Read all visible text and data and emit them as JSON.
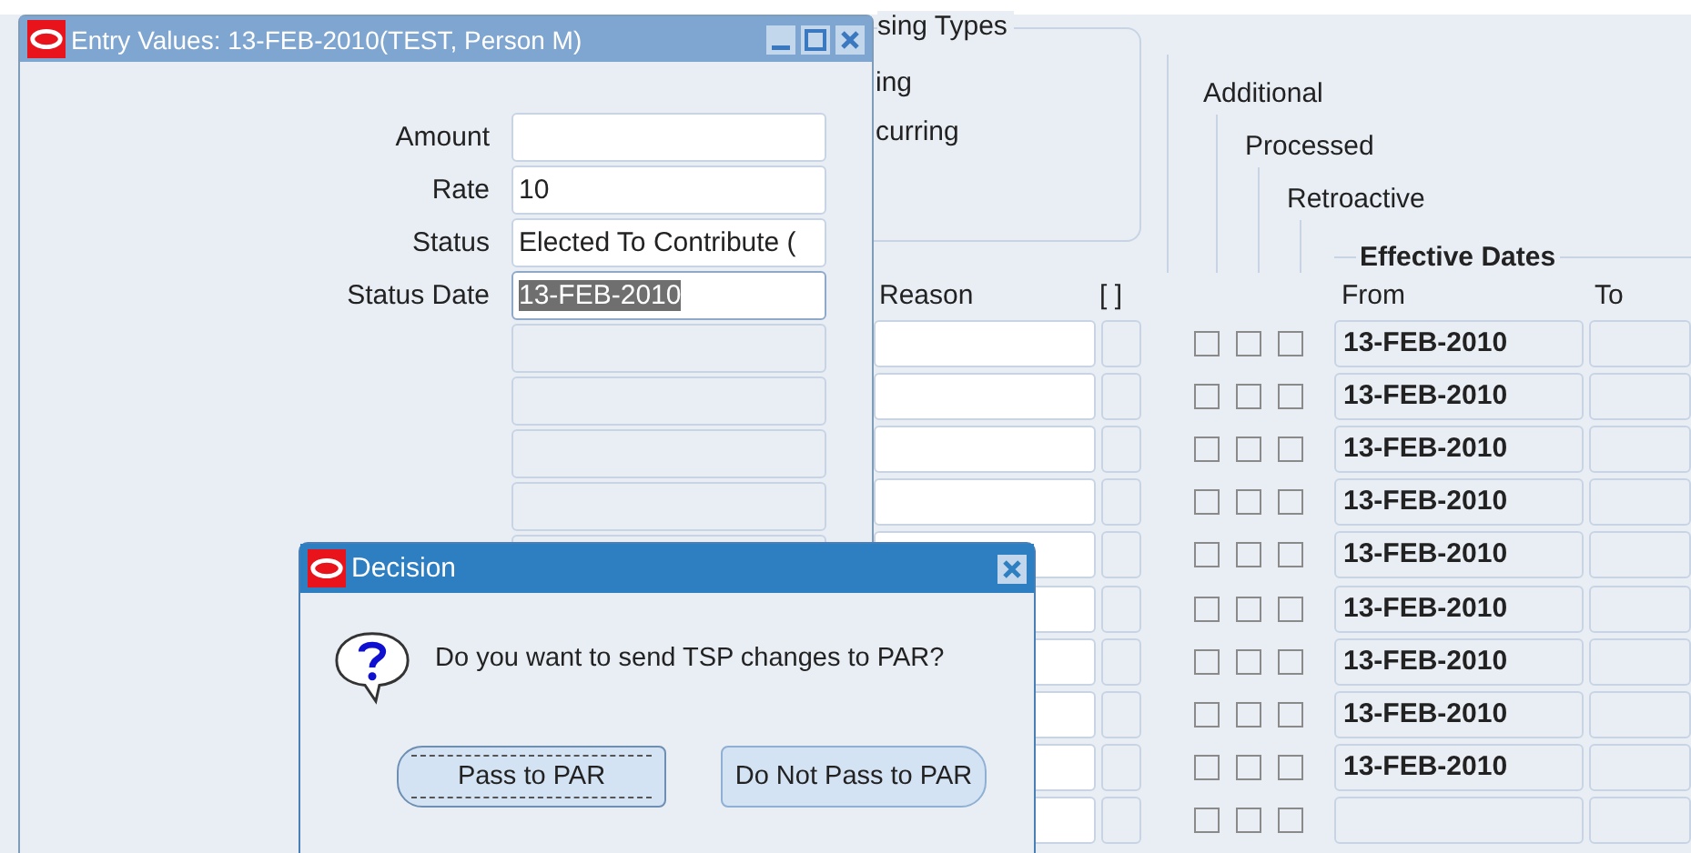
{
  "background_form": {
    "group_title": "sing Types",
    "group_options": [
      "ing",
      "curring"
    ],
    "flag_headers": [
      "Additional",
      "Processed",
      "Retroactive"
    ],
    "columns": {
      "reason": "Reason",
      "column_2": "[ ]",
      "dates_group": "Effective Dates",
      "from": "From",
      "to": "To"
    },
    "rows": [
      {
        "flags": [
          {
            "checked": false
          },
          {
            "checked": false
          },
          {
            "checked": false
          }
        ],
        "from": "13-FEB-2010"
      },
      {
        "flags": [
          {
            "checked": false
          },
          {
            "checked": false
          },
          {
            "checked": false
          }
        ],
        "from": "13-FEB-2010"
      },
      {
        "flags": [
          {
            "checked": false
          },
          {
            "checked": false
          },
          {
            "checked": false
          }
        ],
        "from": "13-FEB-2010"
      },
      {
        "flags": [
          {
            "checked": false
          },
          {
            "checked": false
          },
          {
            "checked": false
          }
        ],
        "from": "13-FEB-2010"
      },
      {
        "flags": [
          {
            "checked": false
          },
          {
            "checked": false
          },
          {
            "checked": false
          }
        ],
        "from": "13-FEB-2010"
      },
      {
        "flags": [
          {
            "checked": false
          },
          {
            "checked": false
          },
          {
            "checked": false
          }
        ],
        "from": "13-FEB-2010"
      },
      {
        "flags": [
          {
            "checked": false
          },
          {
            "checked": false
          },
          {
            "checked": false
          }
        ],
        "from": "13-FEB-2010"
      },
      {
        "flags": [
          {
            "checked": false
          },
          {
            "checked": false
          },
          {
            "checked": false
          }
        ],
        "from": "13-FEB-2010"
      },
      {
        "flags": [
          {
            "checked": false
          },
          {
            "checked": false
          },
          {
            "checked": false
          }
        ],
        "from": "13-FEB-2010"
      },
      {
        "flags": [
          {
            "checked": false
          },
          {
            "checked": false
          },
          {
            "checked": false
          }
        ]
      }
    ]
  },
  "entry_window": {
    "title": "Entry Values: 13-FEB-2010(TEST, Person M)",
    "fields": [
      {
        "kind": "input",
        "label": "Amount",
        "selected": false
      },
      {
        "kind": "input",
        "label": "Rate",
        "value": "10",
        "selected": false
      },
      {
        "kind": "input",
        "label": "Status",
        "value": "Elected To Contribute (",
        "selected": false
      },
      {
        "kind": "input",
        "label": "Status Date",
        "value": "13-FEB-2010",
        "selected": true
      },
      {
        "kind": "blank"
      },
      {
        "kind": "blank"
      },
      {
        "kind": "blank"
      },
      {
        "kind": "blank"
      },
      {
        "kind": "blank"
      }
    ]
  },
  "decision_dialog": {
    "title": "Decision",
    "message": "Do you want to send TSP changes to PAR?",
    "buttons": [
      {
        "label": "Pass to PAR",
        "focused": true
      },
      {
        "label": "Do Not Pass to PAR",
        "focused": false
      }
    ]
  }
}
